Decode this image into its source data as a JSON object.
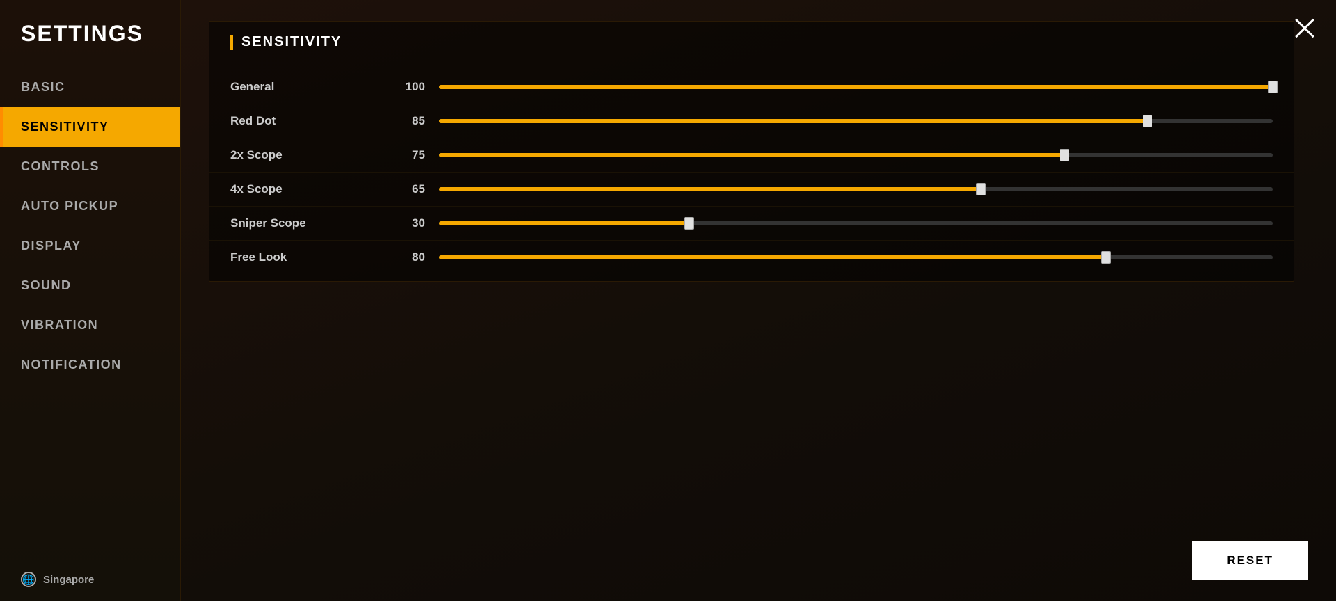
{
  "sidebar": {
    "title": "SETTINGS",
    "items": [
      {
        "id": "basic",
        "label": "BASIC",
        "active": false
      },
      {
        "id": "sensitivity",
        "label": "SENSITIVITY",
        "active": true
      },
      {
        "id": "controls",
        "label": "CONTROLS",
        "active": false
      },
      {
        "id": "auto-pickup",
        "label": "AUTO PICKUP",
        "active": false
      },
      {
        "id": "display",
        "label": "DISPLAY",
        "active": false
      },
      {
        "id": "sound",
        "label": "SOUND",
        "active": false
      },
      {
        "id": "vibration",
        "label": "VIBRATION",
        "active": false
      },
      {
        "id": "notification",
        "label": "NOTIFICATION",
        "active": false
      }
    ],
    "footer": {
      "region": "Singapore",
      "icon": "globe-icon"
    }
  },
  "panel": {
    "title": "SENSITIVITY",
    "sliders": [
      {
        "id": "general",
        "label": "General",
        "value": 100,
        "percent": 100
      },
      {
        "id": "red-dot",
        "label": "Red Dot",
        "value": 85,
        "percent": 85
      },
      {
        "id": "2x-scope",
        "label": "2x Scope",
        "value": 75,
        "percent": 75
      },
      {
        "id": "4x-scope",
        "label": "4x Scope",
        "value": 65,
        "percent": 65
      },
      {
        "id": "sniper-scope",
        "label": "Sniper Scope",
        "value": 30,
        "percent": 30
      },
      {
        "id": "free-look",
        "label": "Free Look",
        "value": 80,
        "percent": 80
      }
    ]
  },
  "buttons": {
    "reset": "RESET",
    "close": "×"
  },
  "colors": {
    "accent": "#f5a800",
    "active_bg": "#f5a800",
    "active_text": "#000000",
    "track_bg": "#333333",
    "thumb_color": "#e0e0e0"
  }
}
